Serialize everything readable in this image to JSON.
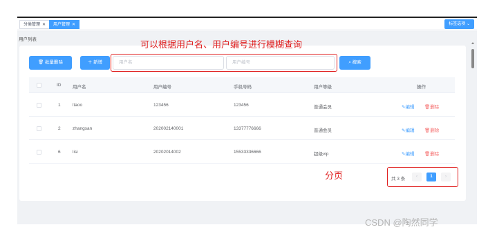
{
  "tabs": [
    {
      "label": "分类管理",
      "active": false
    },
    {
      "label": "用户管理",
      "active": true
    }
  ],
  "tab_options": "标签选项",
  "breadcrumb": "用户列表",
  "toolbar": {
    "batch_delete": "批量删除",
    "add": "新增",
    "search": "搜索",
    "username_placeholder": "用户名",
    "userno_placeholder": "用户编号"
  },
  "annotations": {
    "search_hint": "可以根据用户名、用户编号进行模糊查询",
    "pager_hint": "分页"
  },
  "table": {
    "headers": [
      "ID",
      "用户名",
      "用户编号",
      "手机号码",
      "用户等级",
      "操作"
    ],
    "rows": [
      {
        "id": "1",
        "username": "ltaoo",
        "userno": "123456",
        "phone": "123456",
        "level": "普通会员"
      },
      {
        "id": "2",
        "username": "zhangsan",
        "userno": "202002140001",
        "phone": "13377776666",
        "level": "普通会员"
      },
      {
        "id": "6",
        "username": "lisi",
        "userno": "20202014002",
        "phone": "15533336666",
        "level": "超级vip"
      }
    ],
    "edit_label": "编辑",
    "delete_label": "删除"
  },
  "pagination": {
    "total_text": "共 3 条",
    "current_page": "1"
  },
  "watermark": "CSDN @陶然同学",
  "colors": {
    "primary": "#409eff",
    "danger": "#f56c6c",
    "annotation": "#e02020"
  }
}
